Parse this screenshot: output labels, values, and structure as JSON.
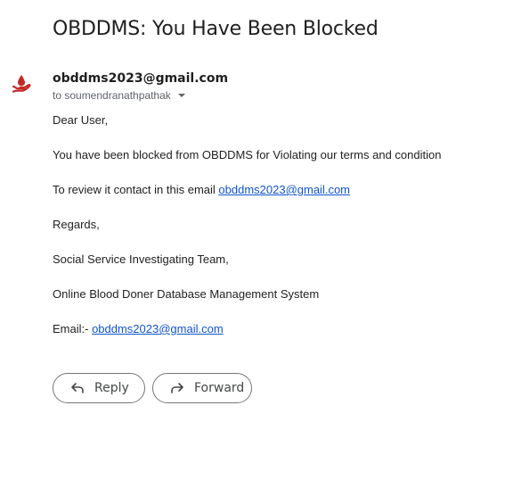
{
  "email": {
    "subject": "OBDDMS: You Have Been Blocked",
    "sender": "obddms2023@gmail.com",
    "recipient_line": "to soumendranathpathak",
    "body": {
      "greeting": "Dear User,",
      "line1": "You have been blocked from OBDDMS for Violating our terms and condition",
      "line2_prefix": "To review it contact in this email ",
      "line2_link": "obddms2023@gmail.com",
      "regards": "Regards,",
      "team": "Social Service Investigating Team,",
      "system": "Online Blood Doner Database Management System",
      "email_prefix": "Email:- ",
      "email_link": "obddms2023@gmail.com"
    }
  },
  "actions": {
    "reply_label": "Reply",
    "forward_label": "Forward"
  },
  "icons": {
    "avatar": "blood-drop-hand-icon",
    "recipient_toggle": "caret-down-icon",
    "reply": "reply-arrow-icon",
    "forward": "forward-arrow-icon"
  },
  "colors": {
    "avatar": "#c62828",
    "link": "#1155cc",
    "button_border": "#747775"
  }
}
